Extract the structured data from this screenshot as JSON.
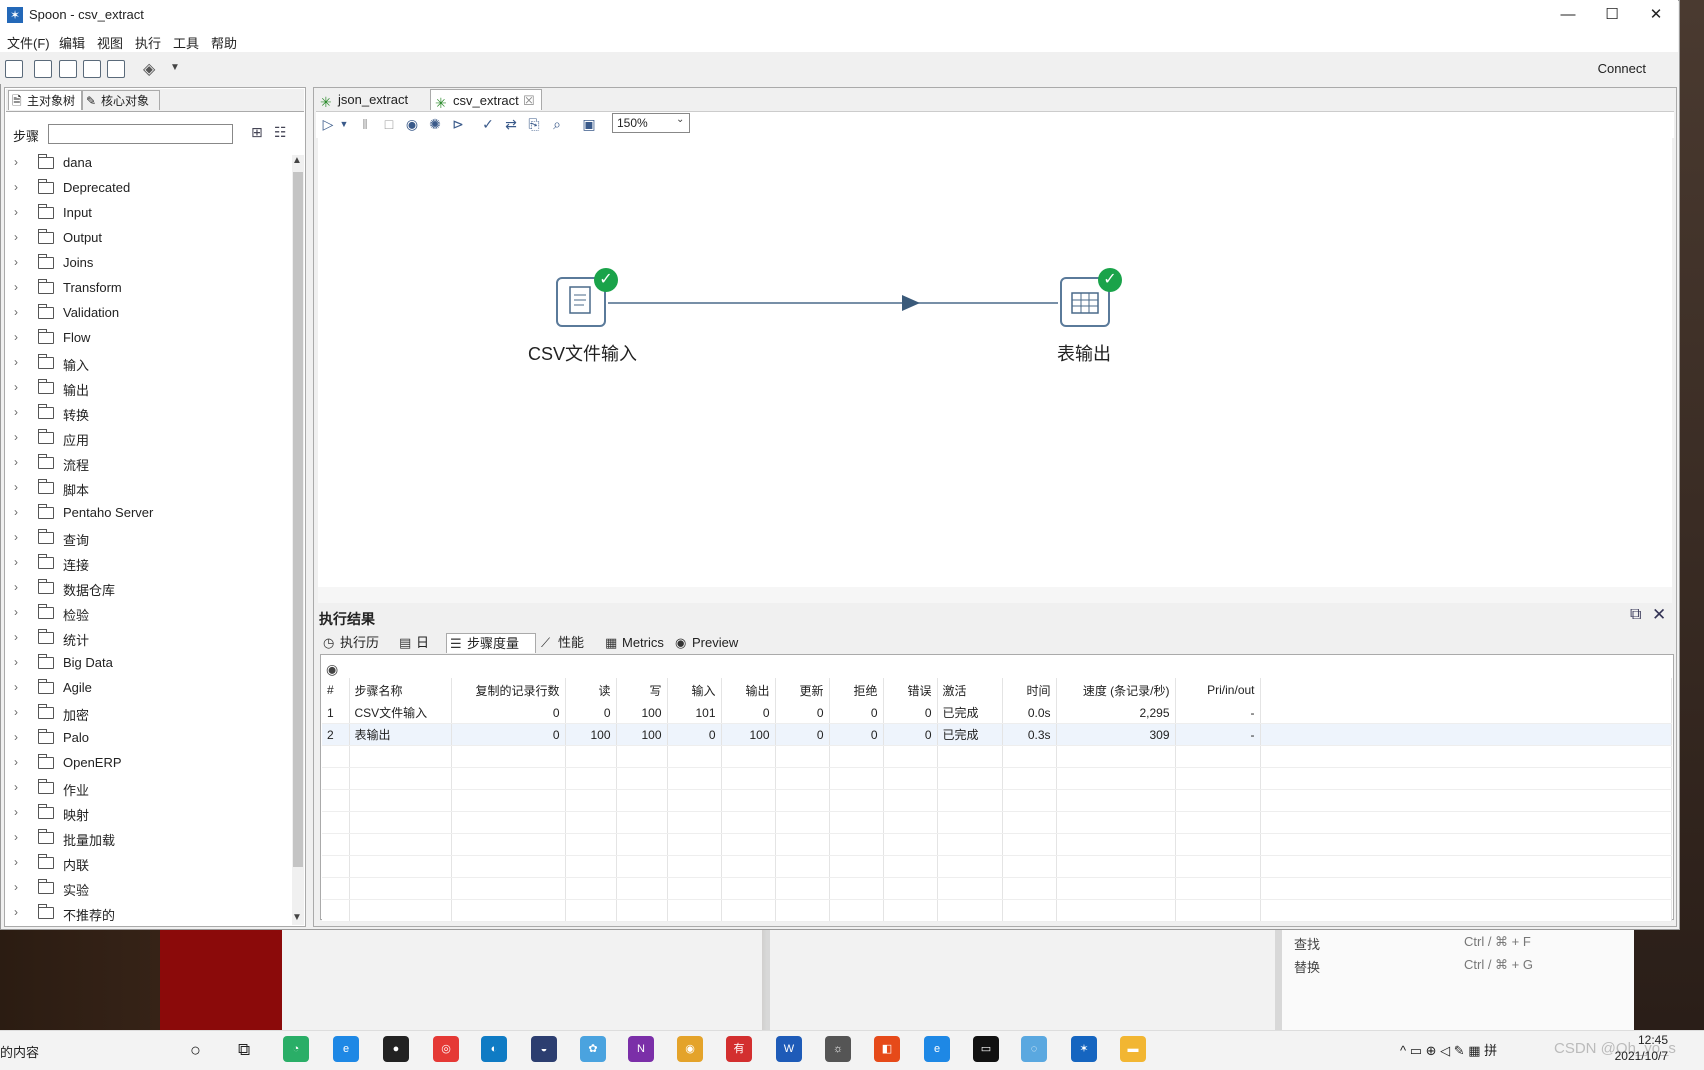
{
  "window": {
    "title": "Spoon - csv_extract",
    "minimize": "—",
    "maximize": "☐",
    "close": "✕"
  },
  "menu": [
    "文件(F)",
    "编辑",
    "视图",
    "执行",
    "工具",
    "帮助"
  ],
  "toolbar": {
    "connect": "Connect"
  },
  "left_tabs": [
    "主对象树",
    "核心对象"
  ],
  "step_search": {
    "label": "步骤",
    "value": ""
  },
  "tree_items": [
    "dana",
    "Deprecated",
    "Input",
    "Output",
    "Joins",
    "Transform",
    "Validation",
    "Flow",
    "输入",
    "输出",
    "转换",
    "应用",
    "流程",
    "脚本",
    "Pentaho Server",
    "查询",
    "连接",
    "数据仓库",
    "检验",
    "统计",
    "Big Data",
    "Agile",
    "加密",
    "Palo",
    "OpenERP",
    "作业",
    "映射",
    "批量加载",
    "内联",
    "实验",
    "不推荐的"
  ],
  "editor_tabs": [
    {
      "label": "json_extract"
    },
    {
      "label": "csv_extract",
      "close": "☒"
    }
  ],
  "zoom": "150%",
  "canvas": {
    "steps": [
      {
        "label": "CSV文件输入"
      },
      {
        "label": "表输出"
      }
    ]
  },
  "results": {
    "title": "执行结果",
    "tabs": [
      "执行历史",
      "日志",
      "步骤度量",
      "性能图",
      "Metrics",
      "Preview data"
    ],
    "columns": [
      "#",
      "步骤名称",
      "复制的记录行数",
      "读",
      "写",
      "输入",
      "输出",
      "更新",
      "拒绝",
      "错误",
      "激活",
      "时间",
      "速度 (条记录/秒)",
      "Pri/in/out"
    ],
    "rows": [
      [
        "1",
        "CSV文件输入",
        "0",
        "0",
        "100",
        "101",
        "0",
        "0",
        "0",
        "0",
        "已完成",
        "0.0s",
        "2,295",
        "-"
      ],
      [
        "2",
        "表输出",
        "0",
        "100",
        "100",
        "0",
        "100",
        "0",
        "0",
        "0",
        "已完成",
        "0.3s",
        "309",
        "-"
      ]
    ]
  },
  "background_shortcuts": [
    {
      "label": "查找",
      "keys": "Ctrl / ⌘ + F"
    },
    {
      "label": "替换",
      "keys": "Ctrl / ⌘ + G"
    }
  ],
  "taskbar": {
    "search_text": "的内容",
    "time": "12:45",
    "date": "2021/10/7",
    "watermark": "CSDN @Oh_yo_s"
  }
}
